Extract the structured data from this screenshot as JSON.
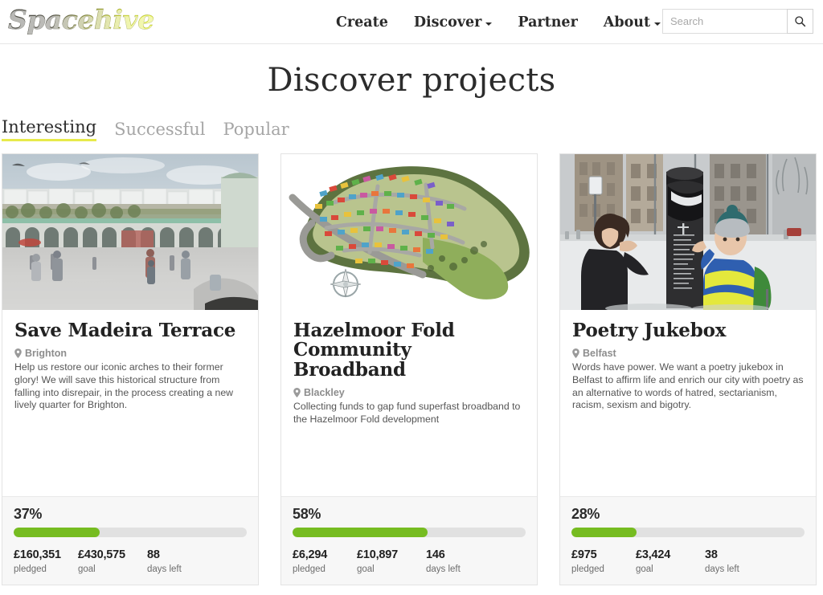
{
  "header": {
    "logo_text": "Spacehive",
    "nav": [
      {
        "label": "Create",
        "has_dropdown": false
      },
      {
        "label": "Discover",
        "has_dropdown": true
      },
      {
        "label": "Partner",
        "has_dropdown": false
      },
      {
        "label": "About",
        "has_dropdown": true
      }
    ],
    "search": {
      "placeholder": "Search",
      "value": "",
      "button_icon": "search-icon"
    }
  },
  "page": {
    "title": "Discover projects",
    "tabs": [
      {
        "label": "Interesting",
        "active": true
      },
      {
        "label": "Successful",
        "active": false
      },
      {
        "label": "Popular",
        "active": false
      }
    ],
    "accent_color": "#e7ea4c",
    "progress_color": "#76bc21"
  },
  "projects": [
    {
      "title": "Save Madeira Terrace",
      "location": "Brighton",
      "location_icon": "map-pin-icon",
      "description": "Help us restore our iconic arches to their former glory! We will save this historical structure from falling into disrepair, in the process creating a new lively quarter for Brighton.",
      "percent_label": "37%",
      "percent_value": 37,
      "pledged": "£160,351",
      "pledged_label": "pledged",
      "goal": "£430,575",
      "goal_label": "goal",
      "days": "88",
      "days_label": "days left",
      "image_alt": "seafront promenade arches architectural rendering"
    },
    {
      "title": "Hazelmoor Fold Community Broadband",
      "location": "Blackley",
      "location_icon": "map-pin-icon",
      "description": "Collecting funds to gap fund superfast broadband to the Hazelmoor Fold development",
      "percent_label": "58%",
      "percent_value": 58,
      "pledged": "£6,294",
      "pledged_label": "pledged",
      "goal": "£10,897",
      "goal_label": "goal",
      "days": "146",
      "days_label": "days left",
      "image_alt": "aerial site plan of housing development with compass rose"
    },
    {
      "title": "Poetry Jukebox",
      "location": "Belfast",
      "location_icon": "map-pin-icon",
      "description": "Words have power. We want a poetry jukebox in Belfast to affirm life and enrich our city with poetry as an alternative to words of hatred, sectarianism, racism, sexism and bigotry.",
      "percent_label": "28%",
      "percent_value": 28,
      "pledged": "£975",
      "pledged_label": "pledged",
      "goal": "£3,424",
      "goal_label": "goal",
      "days": "38",
      "days_label": "days left",
      "image_alt": "woman and child listening to dark cylindrical poetry jukebox in snow"
    }
  ]
}
